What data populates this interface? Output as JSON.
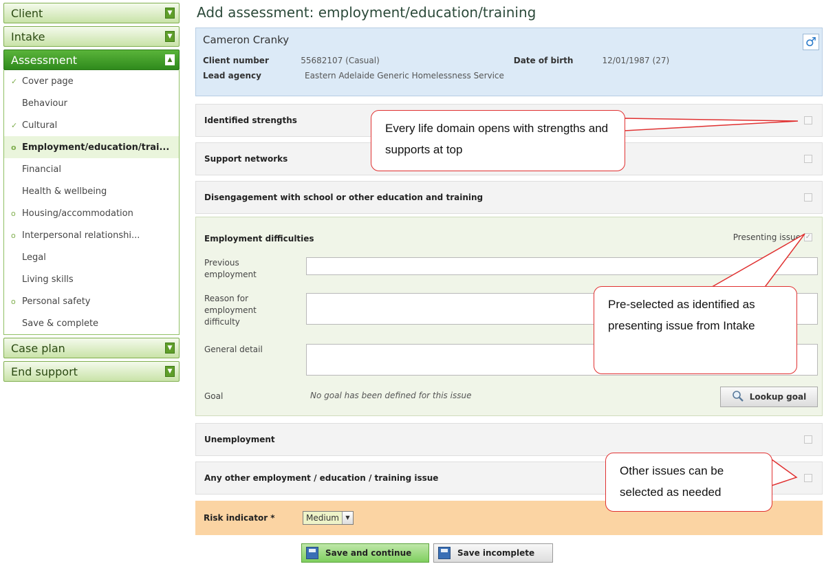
{
  "sidebar": {
    "sections": {
      "client": "Client",
      "intake": "Intake",
      "assessment": "Assessment",
      "case_plan": "Case plan",
      "end_support": "End support"
    },
    "assessment_items": [
      {
        "label": "Cover page",
        "mark": "✓"
      },
      {
        "label": "Behaviour",
        "mark": ""
      },
      {
        "label": "Cultural",
        "mark": "✓"
      },
      {
        "label": "Employment/education/trai...",
        "mark": "o"
      },
      {
        "label": "Financial",
        "mark": ""
      },
      {
        "label": "Health & wellbeing",
        "mark": ""
      },
      {
        "label": "Housing/accommodation",
        "mark": "o"
      },
      {
        "label": "Interpersonal relationshi...",
        "mark": "o"
      },
      {
        "label": "Legal",
        "mark": ""
      },
      {
        "label": "Living skills",
        "mark": ""
      },
      {
        "label": "Personal safety",
        "mark": "o"
      },
      {
        "label": "Save & complete",
        "mark": ""
      }
    ]
  },
  "page": {
    "title": "Add assessment: employment/education/training"
  },
  "client": {
    "name": "Cameron Cranky",
    "client_number_label": "Client number",
    "client_number": "55682107 (Casual)",
    "dob_label": "Date of birth",
    "dob": "12/01/1987 (27)",
    "lead_agency_label": "Lead agency",
    "lead_agency": "Eastern Adelaide Generic Homelessness Service",
    "gender_icon": "male-symbol-icon"
  },
  "issues": {
    "identified_strengths": "Identified strengths",
    "support_networks": "Support networks",
    "disengagement": "Disengagement with school or other education and training",
    "employment_difficulties": "Employment difficulties",
    "unemployment": "Unemployment",
    "other": "Any other employment / education / training issue"
  },
  "employment_form": {
    "presenting_issue": "Presenting issue",
    "presenting_checked": true,
    "previous_employment": "Previous employment",
    "reason": "Reason for employment difficulty",
    "general_detail": "General detail",
    "goal_label": "Goal",
    "goal_text": "No goal has been defined for this issue",
    "lookup_button": "Lookup goal"
  },
  "risk": {
    "label": "Risk indicator *",
    "value": "Medium"
  },
  "buttons": {
    "save_continue": "Save and continue",
    "save_incomplete": "Save incomplete"
  },
  "callouts": {
    "strengths": "Every life domain opens with strengths and supports at top",
    "preselected": "Pre-selected as identified as presenting issue from Intake",
    "other_issues": "Other issues can be selected as needed"
  },
  "colors": {
    "accent_green": "#5ab43a",
    "callout_red": "#e03030",
    "risk_orange": "#fbd4a3",
    "client_blue": "#dceaf7"
  }
}
